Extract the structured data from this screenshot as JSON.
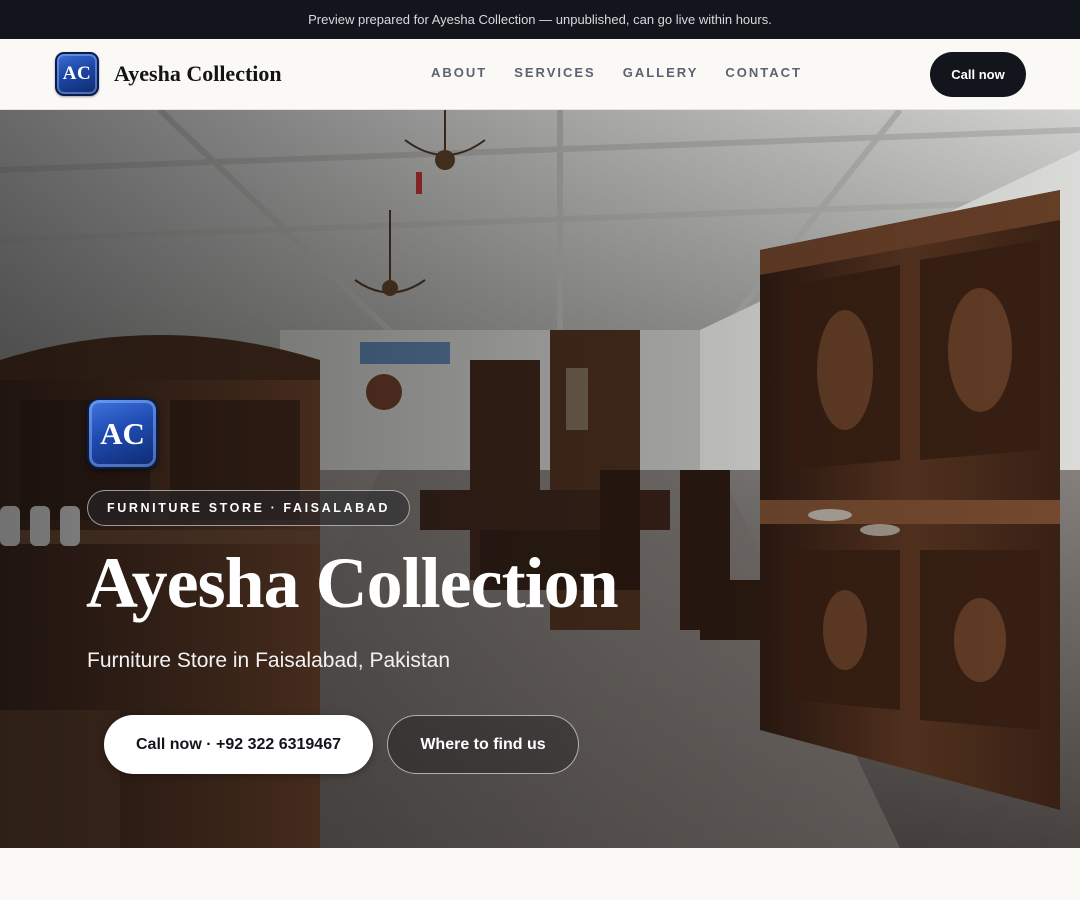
{
  "preview_banner": "Preview prepared for Ayesha Collection — unpublished, can go live within hours.",
  "header": {
    "logo_text": "AC",
    "brand_name": "Ayesha Collection",
    "nav": [
      "ABOUT",
      "SERVICES",
      "GALLERY",
      "CONTACT"
    ],
    "cta_label": "Call now"
  },
  "hero": {
    "logo_text": "AC",
    "badge": "FURNITURE STORE · FAISALABAD",
    "title": "Ayesha Collection",
    "subtitle": "Furniture Store in Faisalabad, Pakistan",
    "primary_button": "Call now · +92 322 6319467",
    "secondary_button": "Where to find us"
  },
  "colors": {
    "topbar_bg": "#12151b",
    "page_bg": "#faf9f6",
    "accent_dark": "#12151b",
    "logo_blue": "#1d47a6",
    "nav_text": "#5b6270"
  }
}
